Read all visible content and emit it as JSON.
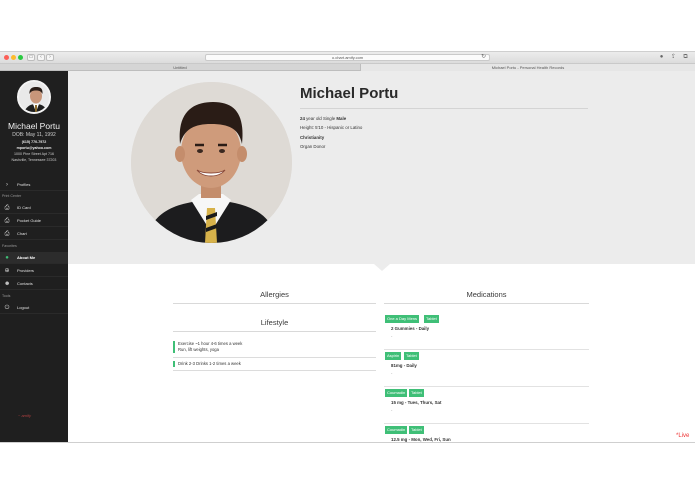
{
  "browser": {
    "url": "o.chart.amify.com",
    "tab_left": "Untitled",
    "tab_right": "Michael Portu - Personal Health Records"
  },
  "sidebar": {
    "name": "Michael Portu",
    "dob": "DOB: May 11, 1992",
    "phone": "(615) 770-7972",
    "email": "mportu@yahoo.com",
    "address1": "1000 Pine Street Apt 716",
    "address2": "Nashville, Tennessee 37203",
    "items": [
      {
        "label": "Profiles",
        "icon": "chevron-right-icon"
      },
      {
        "label": "ID Card",
        "icon": "printer-icon"
      },
      {
        "label": "Pocket Guide",
        "icon": "printer-icon"
      },
      {
        "label": "Chart",
        "icon": "printer-icon"
      },
      {
        "label": "About Me",
        "icon": "person-icon"
      },
      {
        "label": "Providers",
        "icon": "plus-circle-icon"
      },
      {
        "label": "Contacts",
        "icon": "group-icon"
      },
      {
        "label": "Logout",
        "icon": "power-icon"
      }
    ],
    "sections": {
      "print_center": "Print Center",
      "favorites": "Favorites",
      "tools": "Tools"
    },
    "logo_text": "~ amify"
  },
  "profile": {
    "name": "Michael Portu",
    "age": "24",
    "age_suffix": " year old Single ",
    "sex": "Male",
    "height_line": "Height: 5'10 - Hispanic or Latino",
    "religion": "Christianity",
    "donor": "Organ Donor"
  },
  "sections": {
    "allergies": "Allergies",
    "lifestyle": "Lifestyle",
    "medications": "Medications"
  },
  "lifestyle": [
    {
      "line1": "Exercise ~1 hour 4-6 times a week",
      "line2": "Run, lift weights, yoga"
    },
    {
      "line1": "Drink 2-3 Drinks 1-2 times a week",
      "line2": ""
    }
  ],
  "medications": [
    {
      "name": "One a Day Mens",
      "form": "Tablet",
      "dose": "2 Gummies - Daily",
      "note": "-"
    },
    {
      "name": "Aspirin",
      "form": "Tablet",
      "dose": "81mg - Daily",
      "note": "-"
    },
    {
      "name": "Coumadin",
      "form": "Tablet",
      "dose": "15 mg - Tues, Thurs, Sat",
      "note": "-"
    },
    {
      "name": "Coumadin",
      "form": "Tablet",
      "dose": "12.5 mg - Mon, Wed, Fri, Sun",
      "note": ""
    }
  ],
  "live_label": "*Live",
  "colors": {
    "accent": "#3fbf77",
    "sidebar_bg": "#1f1f1f",
    "hero_bg": "#ececec"
  }
}
